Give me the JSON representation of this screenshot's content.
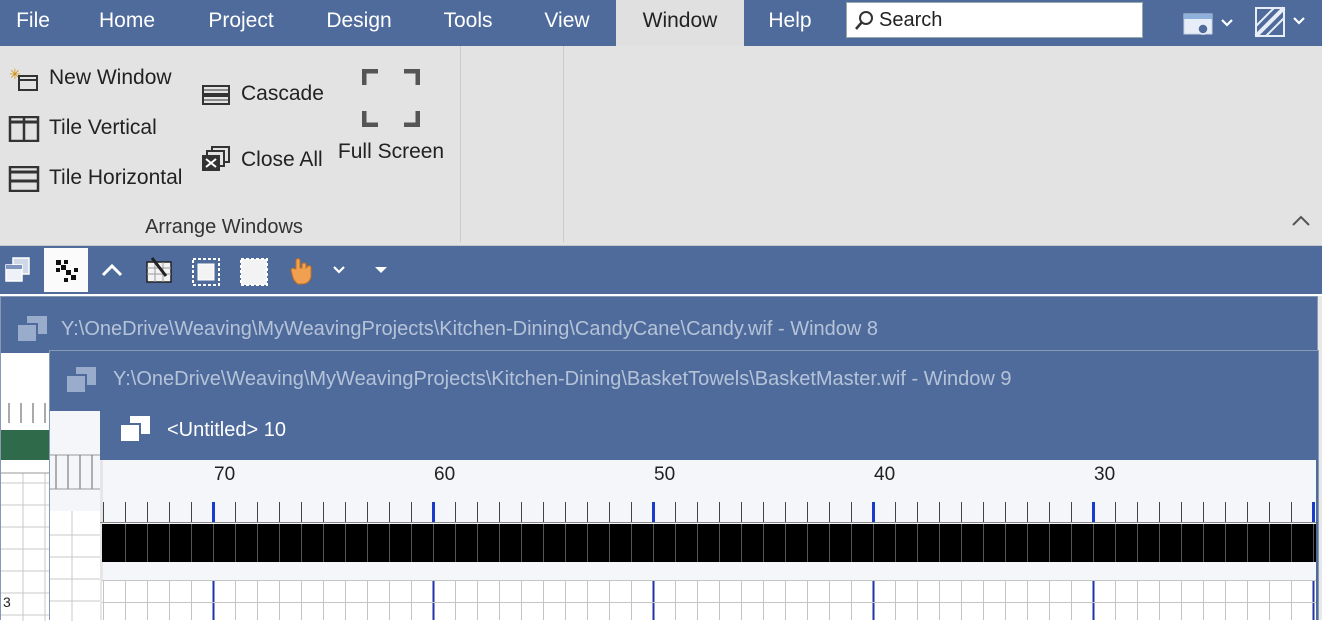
{
  "menu": {
    "items": [
      "File",
      "Home",
      "Project",
      "Design",
      "Tools",
      "View",
      "Window",
      "Help"
    ],
    "active": "Window"
  },
  "search": {
    "placeholder": "Search"
  },
  "ribbon": {
    "new_window": "New Window",
    "tile_vertical": "Tile Vertical",
    "tile_horizontal": "Tile Horizontal",
    "cascade": "Cascade",
    "close_all": "Close All",
    "full_screen": "Full Screen",
    "group_label": "Arrange Windows"
  },
  "windows": [
    {
      "title": "Y:\\OneDrive\\Weaving\\MyWeavingProjects\\Kitchen-Dining\\CandyCane\\Candy.wif - Window 8"
    },
    {
      "title": "Y:\\OneDrive\\Weaving\\MyWeavingProjects\\Kitchen-Dining\\BasketTowels\\BasketMaster.wif - Window 9"
    },
    {
      "title": "<Untitled> 10"
    }
  ],
  "ruler": {
    "labels": [
      "70",
      "60",
      "50",
      "40",
      "30"
    ]
  },
  "left_ruler": {
    "number": "3"
  },
  "colors": {
    "accent": "#4f6b9b",
    "ribbon_bg": "#e3e3e3",
    "threading_fill": "#000000",
    "major_tick": "#1a3ccc",
    "warp_color_strip": "#2f6a4a"
  }
}
